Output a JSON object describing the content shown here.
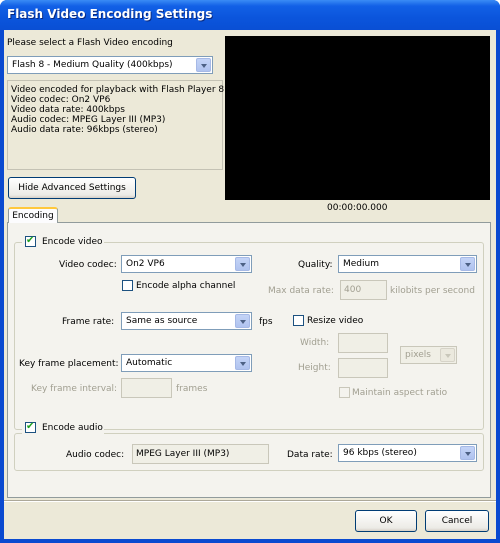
{
  "window": {
    "title": "Flash Video Encoding Settings"
  },
  "encoding": {
    "prompt": "Please select a Flash Video encoding",
    "selected": "Flash 8 - Medium Quality (400kbps)",
    "info": [
      "Video encoded for playback with Flash Player 8",
      "Video codec: On2 VP6",
      "Video data rate: 400kbps",
      "Audio codec: MPEG Layer III (MP3)",
      "Audio data rate: 96kbps (stereo)"
    ]
  },
  "advanced_button": "Hide Advanced Settings",
  "preview": {
    "timecode": "00:00:00.000"
  },
  "tabs": [
    {
      "label": "Encoding"
    }
  ],
  "video": {
    "encode_label": "Encode video",
    "encode_checked": true,
    "codec_label": "Video codec:",
    "codec_value": "On2 VP6",
    "alpha_label": "Encode alpha channel",
    "alpha_checked": false,
    "quality_label": "Quality:",
    "quality_value": "Medium",
    "max_rate_label": "Max data rate:",
    "max_rate_value": "400",
    "max_rate_unit": "kilobits per second",
    "frame_rate_label": "Frame rate:",
    "frame_rate_value": "Same as source",
    "fps_label": "fps",
    "resize_label": "Resize video",
    "resize_checked": false,
    "width_label": "Width:",
    "height_label": "Height:",
    "units_value": "pixels",
    "maintain_label": "Maintain aspect ratio",
    "maintain_checked": false,
    "keyframe_placement_label": "Key frame placement:",
    "keyframe_placement_value": "Automatic",
    "keyframe_interval_label": "Key frame interval:",
    "frames_label": "frames"
  },
  "audio": {
    "encode_label": "Encode audio",
    "encode_checked": true,
    "codec_label": "Audio codec:",
    "codec_value": "MPEG Layer III (MP3)",
    "data_rate_label": "Data rate:",
    "data_rate_value": "96 kbps (stereo)"
  },
  "buttons": {
    "ok": "OK",
    "cancel": "Cancel"
  },
  "icons": {
    "check": "✔"
  }
}
